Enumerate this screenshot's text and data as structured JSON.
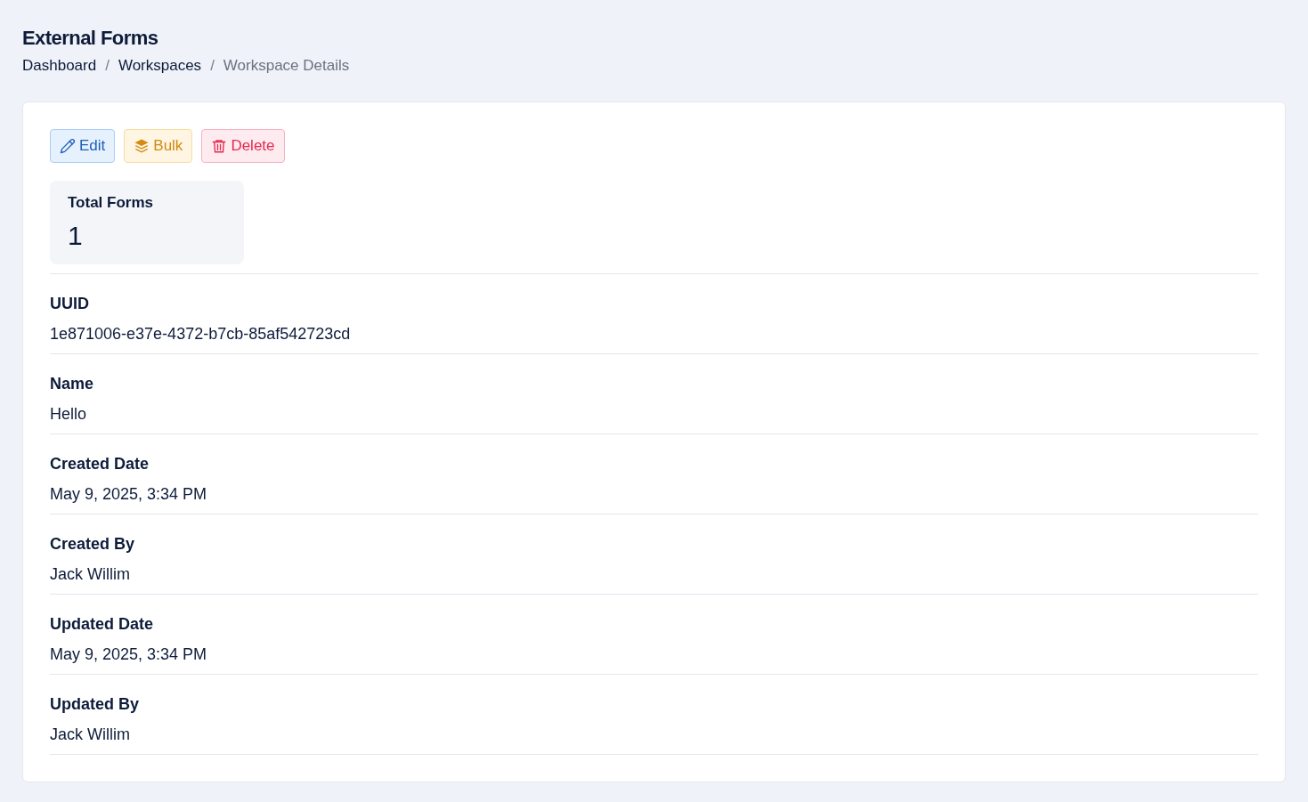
{
  "page": {
    "title": "External Forms"
  },
  "breadcrumb": [
    {
      "kind": "link",
      "label": "Dashboard"
    },
    {
      "kind": "separator",
      "label": "/"
    },
    {
      "kind": "link",
      "label": "Workspaces"
    },
    {
      "kind": "separator",
      "label": "/"
    },
    {
      "kind": "current",
      "label": "Workspace Details"
    }
  ],
  "actions": [
    {
      "kind": "edit",
      "label": "Edit"
    },
    {
      "kind": "bulk",
      "label": "Bulk"
    },
    {
      "kind": "delete",
      "label": "Delete"
    }
  ],
  "stat": {
    "label": "Total Forms",
    "value": "1"
  },
  "fields": [
    {
      "label": "UUID",
      "value": "1e871006-e37e-4372-b7cb-85af542723cd"
    },
    {
      "label": "Name",
      "value": "Hello"
    },
    {
      "label": "Created Date",
      "value": "May 9, 2025, 3:34 PM"
    },
    {
      "label": "Created By",
      "value": "Jack Willim"
    },
    {
      "label": "Updated Date",
      "value": "May 9, 2025, 3:34 PM"
    },
    {
      "label": "Updated By",
      "value": "Jack Willim"
    }
  ]
}
